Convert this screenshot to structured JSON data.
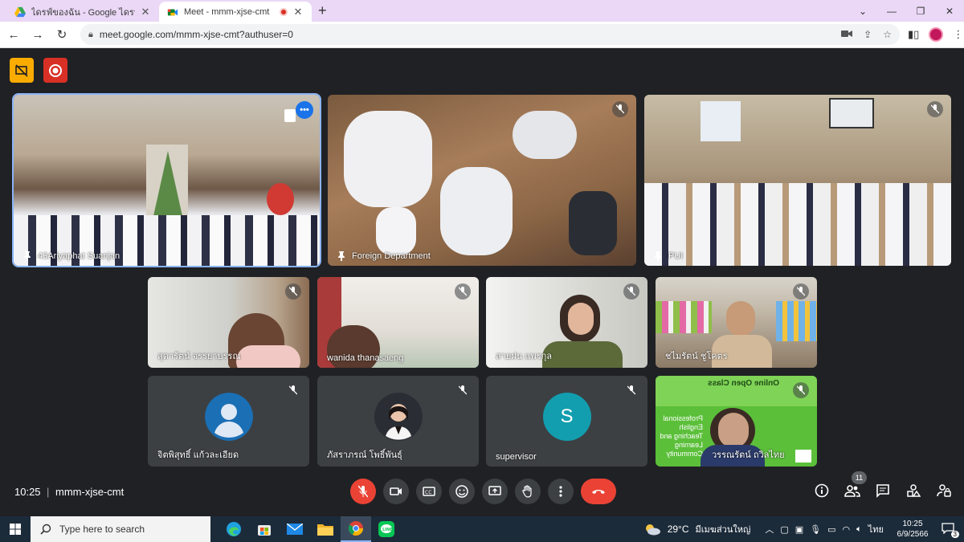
{
  "browser": {
    "tabs": [
      {
        "title": "ไดรฟ์ของฉัน - Google ไดรฟ์",
        "active": false
      },
      {
        "title": "Meet - mmm-xjse-cmt",
        "active": true
      }
    ],
    "url": "meet.google.com/mmm-xjse-cmt?authuser=0"
  },
  "meet": {
    "participants_top": [
      {
        "name": "43Ariyaphat Suanjan"
      },
      {
        "name": "Foreign Department"
      },
      {
        "name": "PUI"
      }
    ],
    "participants_mid": [
      {
        "name": "สุดารัตน์ จรรยาบรรณ"
      },
      {
        "name": "wanida thanasaeng"
      },
      {
        "name": "สายฝน แพรกุล"
      },
      {
        "name": "ชไมรัตน์ ชูโคตร"
      }
    ],
    "participants_bot": [
      {
        "name": "จิตพิสุทธิ์ แก้วละเอียด"
      },
      {
        "name": "ภัสราภรณ์ โพธิ์พันธุ์"
      },
      {
        "name": "supervisor",
        "initial": "S"
      },
      {
        "name": "วรรณรัตน์ ถวิลไทย",
        "slide_title": "Online Open Class",
        "slide_body": "Professional English Teaching and Learning Community"
      }
    ],
    "time": "10:25",
    "meeting_code": "mmm-xjse-cmt",
    "people_count": "11"
  },
  "taskbar": {
    "search_placeholder": "Type here to search",
    "weather": "29°C",
    "weather_desc": "มีเมฆส่วนใหญ่",
    "lang": "ไทย",
    "time": "10:25",
    "date": "6/9/2566",
    "notif_count": "3"
  }
}
